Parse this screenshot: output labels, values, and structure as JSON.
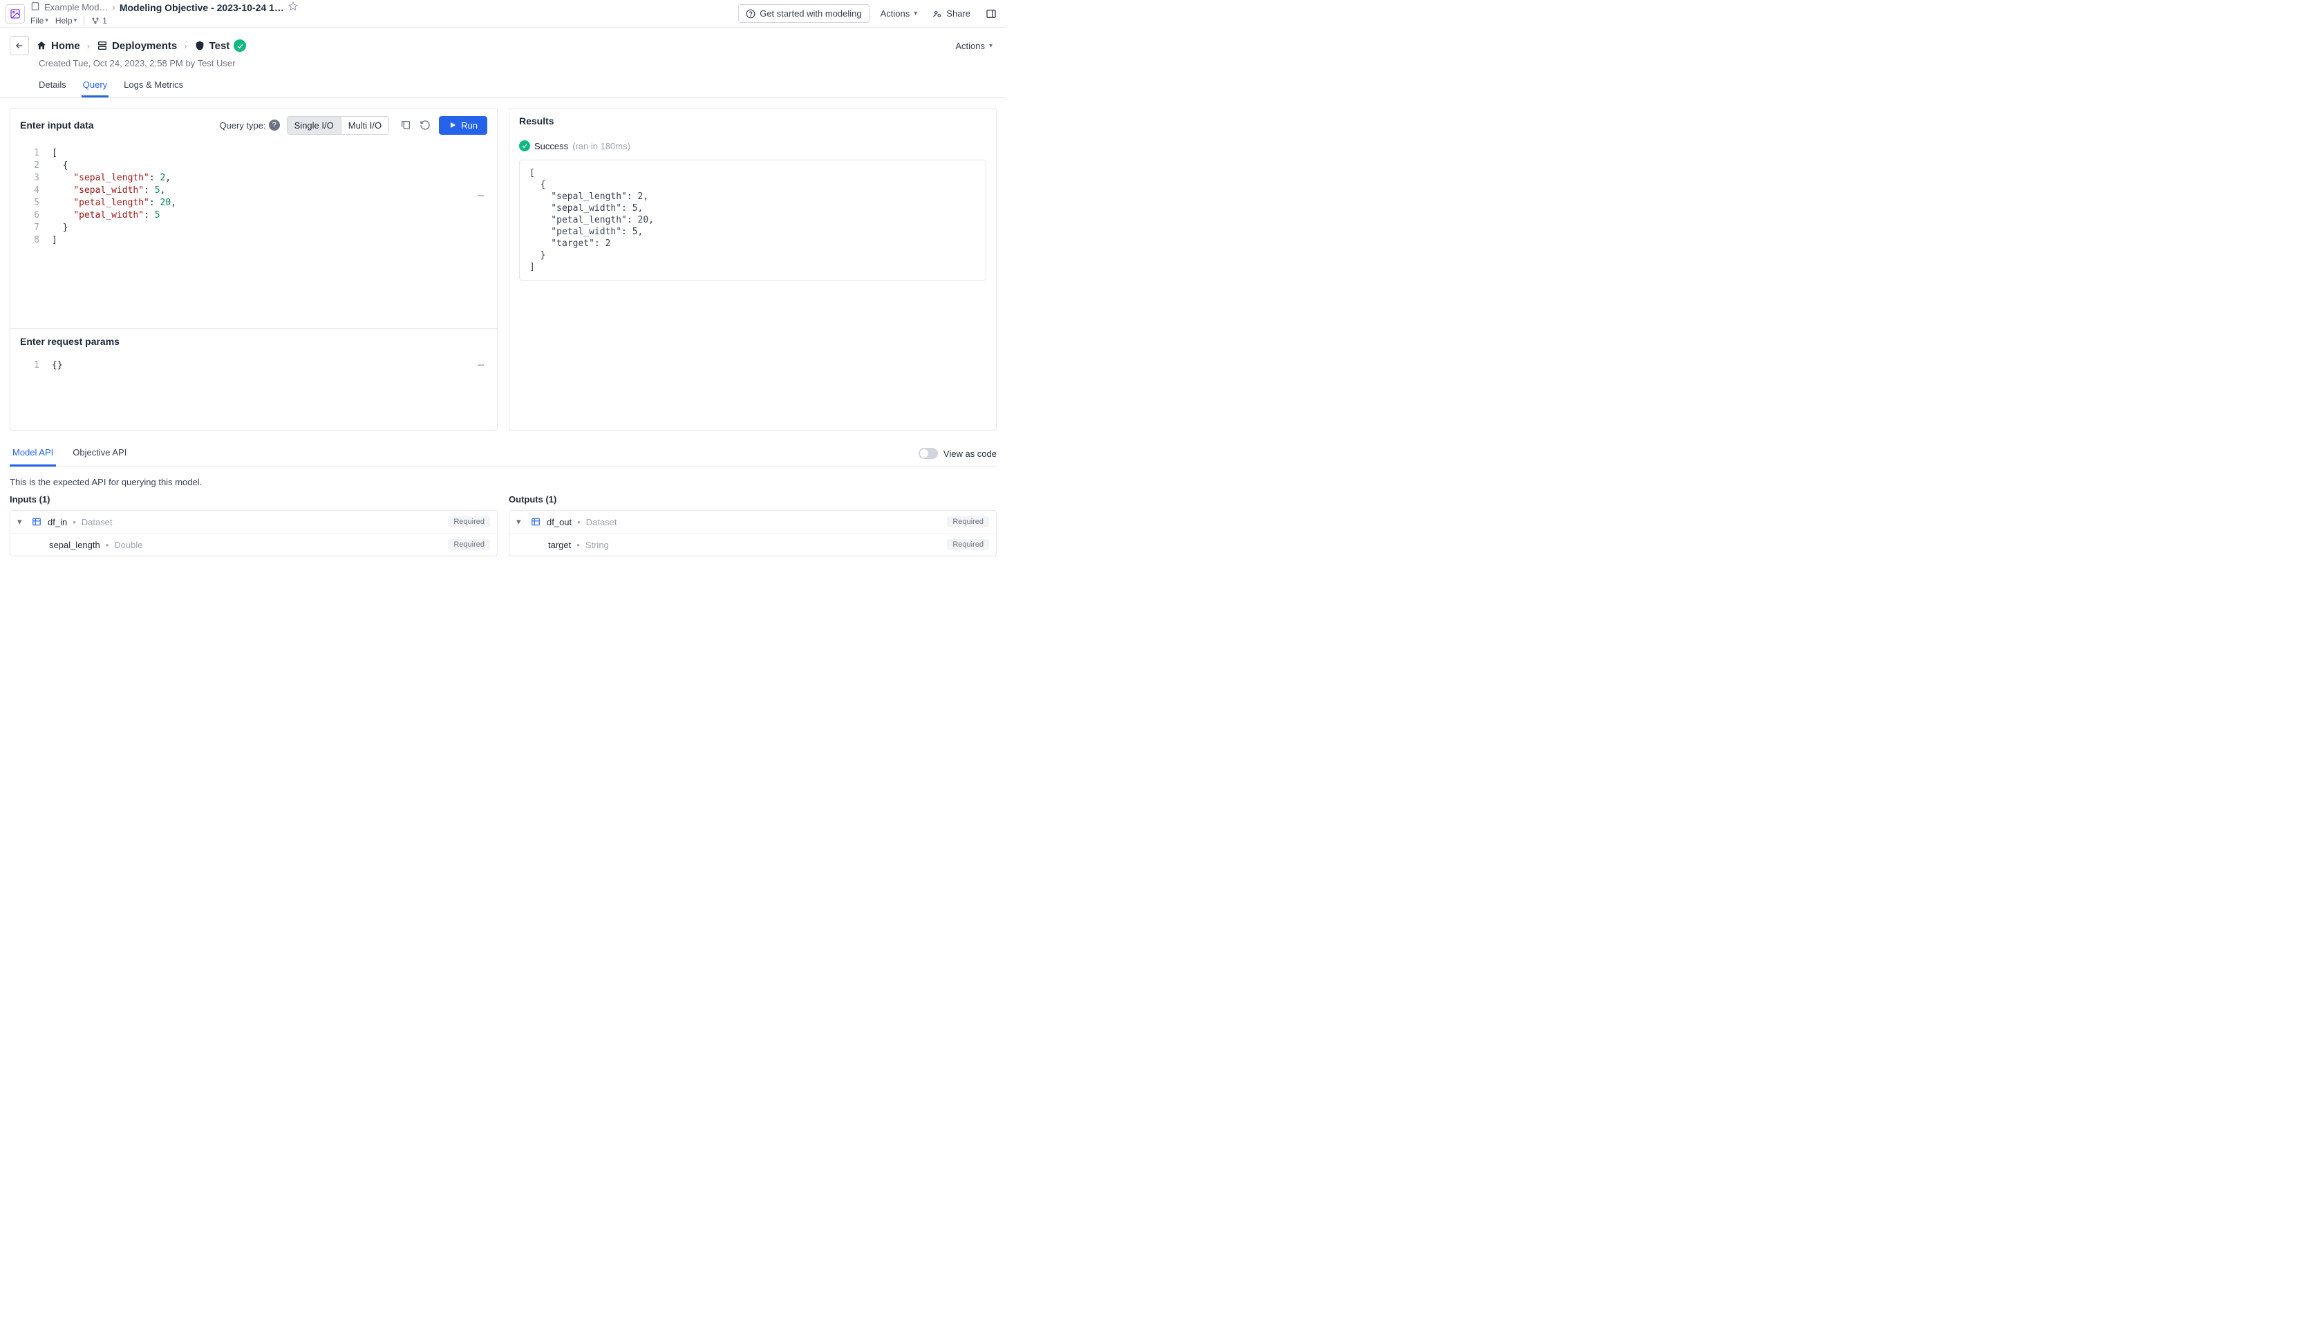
{
  "header": {
    "project_crumb": "Example Mod…",
    "page_title": "Modeling Objective - 2023-10-24 1…",
    "file_menu": "File",
    "help_menu": "Help",
    "branch_count": "1",
    "get_started": "Get started with modeling",
    "actions": "Actions",
    "share": "Share"
  },
  "breadcrumb": {
    "home": "Home",
    "deployments": "Deployments",
    "test": "Test",
    "actions": "Actions"
  },
  "created": "Created Tue, Oct 24, 2023, 2:58 PM by Test User",
  "tabs": {
    "details": "Details",
    "query": "Query",
    "logs": "Logs & Metrics"
  },
  "input": {
    "title": "Enter input data",
    "query_type_label": "Query type:",
    "single": "Single I/O",
    "multi": "Multi I/O",
    "run": "Run",
    "code_lines": [
      {
        "g": "1",
        "plain": "["
      },
      {
        "g": "2",
        "plain": "  {"
      },
      {
        "g": "3",
        "key": "\"sepal_length\"",
        "sep": ": ",
        "num": "2",
        "trail": ","
      },
      {
        "g": "4",
        "key": "\"sepal_width\"",
        "sep": ": ",
        "num": "5",
        "trail": ","
      },
      {
        "g": "5",
        "key": "\"petal_length\"",
        "sep": ": ",
        "num": "20",
        "trail": ","
      },
      {
        "g": "6",
        "key": "\"petal_width\"",
        "sep": ": ",
        "num": "5",
        "trail": ""
      },
      {
        "g": "7",
        "plain": "  }"
      },
      {
        "g": "8",
        "plain": "]"
      }
    ],
    "params_title": "Enter request params",
    "params_line_g": "1",
    "params_line": "{}"
  },
  "results": {
    "title": "Results",
    "status": "Success",
    "meta": "(ran in 180ms)",
    "body": "[\n  {\n    \"sepal_length\": 2,\n    \"sepal_width\": 5,\n    \"petal_length\": 20,\n    \"petal_width\": 5,\n    \"target\": 2\n  }\n]"
  },
  "api": {
    "tab_model": "Model API",
    "tab_objective": "Objective API",
    "view_as_code": "View as code",
    "desc": "This is the expected API for querying this model.",
    "inputs_title": "Inputs (1)",
    "outputs_title": "Outputs (1)",
    "required": "Required",
    "in_ds_name": "df_in",
    "in_ds_type": "Dataset",
    "in_f_name": "sepal_length",
    "in_f_type": "Double",
    "out_ds_name": "df_out",
    "out_ds_type": "Dataset",
    "out_f_name": "target",
    "out_f_type": "String"
  }
}
